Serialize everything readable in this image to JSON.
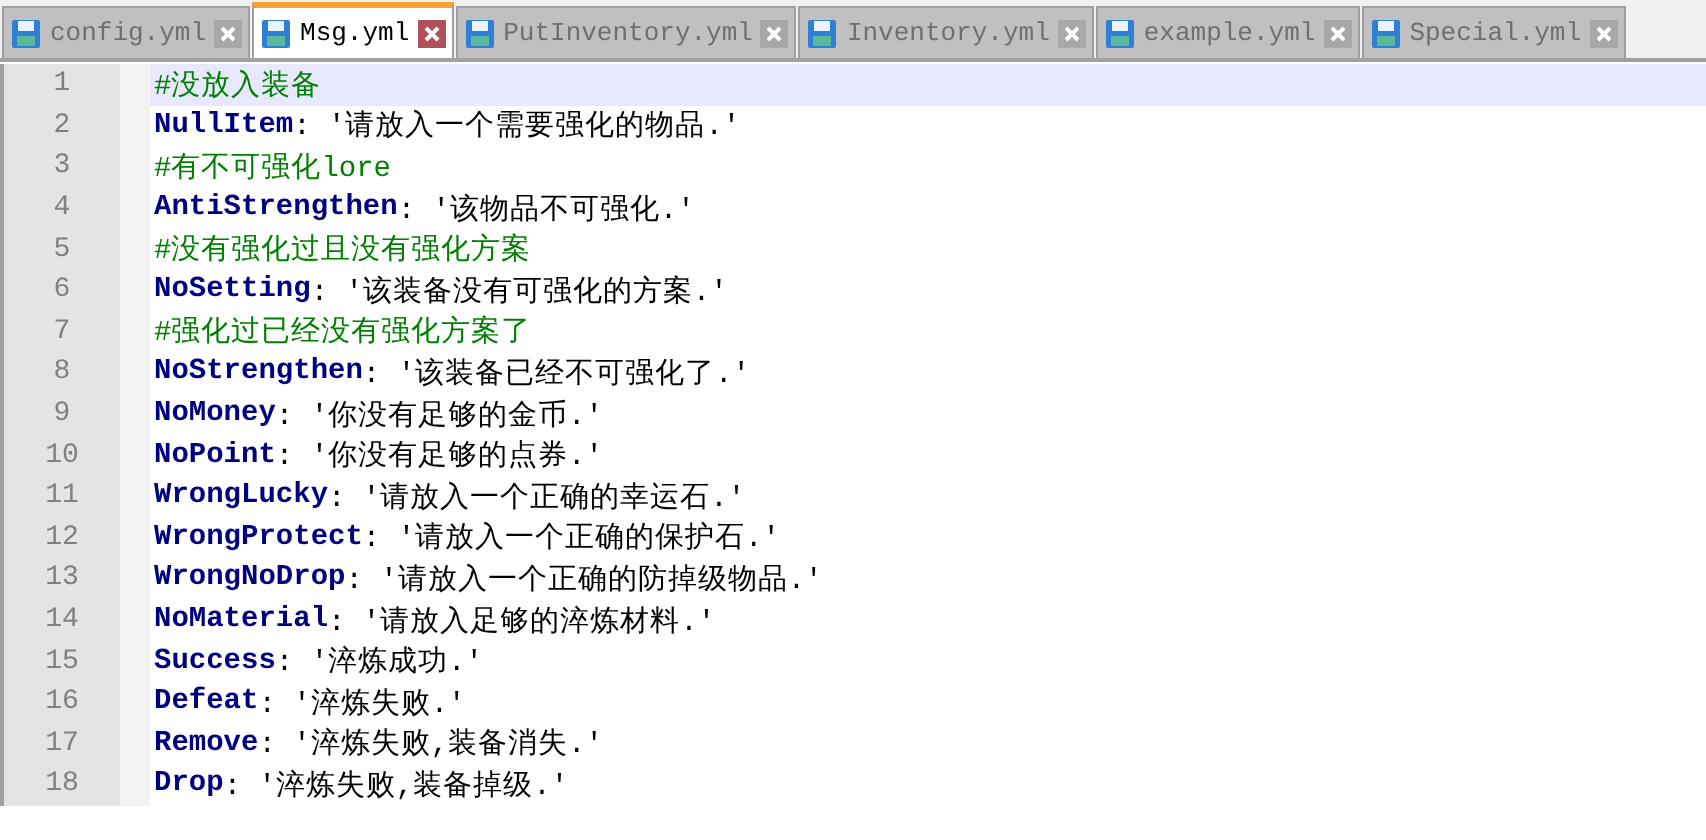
{
  "tabs": [
    {
      "label": "config.yml",
      "selected": false
    },
    {
      "label": "Msg.yml",
      "selected": true
    },
    {
      "label": "PutInventory.yml",
      "selected": false
    },
    {
      "label": "Inventory.yml",
      "selected": false
    },
    {
      "label": "example.yml",
      "selected": false
    },
    {
      "label": "Special.yml",
      "selected": false
    }
  ],
  "lines": [
    {
      "number": "1",
      "kind": "comment",
      "text": "#没放入装备",
      "current": true
    },
    {
      "number": "2",
      "kind": "entry",
      "key": "NullItem",
      "colon": ":",
      "value": "'请放入一个需要强化的物品.'",
      "current": false
    },
    {
      "number": "3",
      "kind": "comment",
      "text": "#有不可强化lore",
      "current": false
    },
    {
      "number": "4",
      "kind": "entry",
      "key": "AntiStrengthen",
      "colon": ":",
      "value": "'该物品不可强化.'",
      "current": false
    },
    {
      "number": "5",
      "kind": "comment",
      "text": "#没有强化过且没有强化方案",
      "current": false
    },
    {
      "number": "6",
      "kind": "entry",
      "key": "NoSetting",
      "colon": ":",
      "value": "'该装备没有可强化的方案.'",
      "current": false
    },
    {
      "number": "7",
      "kind": "comment",
      "text": "#强化过已经没有强化方案了",
      "current": false
    },
    {
      "number": "8",
      "kind": "entry",
      "key": "NoStrengthen",
      "colon": ":",
      "value": "'该装备已经不可强化了.'",
      "current": false
    },
    {
      "number": "9",
      "kind": "entry",
      "key": "NoMoney",
      "colon": ":",
      "value": "'你没有足够的金币.'",
      "current": false
    },
    {
      "number": "10",
      "kind": "entry",
      "key": "NoPoint",
      "colon": ":",
      "value": "'你没有足够的点券.'",
      "current": false
    },
    {
      "number": "11",
      "kind": "entry",
      "key": "WrongLucky",
      "colon": ":",
      "value": "'请放入一个正确的幸运石.'",
      "current": false
    },
    {
      "number": "12",
      "kind": "entry",
      "key": "WrongProtect",
      "colon": ":",
      "value": "'请放入一个正确的保护石.'",
      "current": false
    },
    {
      "number": "13",
      "kind": "entry",
      "key": "WrongNoDrop",
      "colon": ":",
      "value": "'请放入一个正确的防掉级物品.'",
      "current": false
    },
    {
      "number": "14",
      "kind": "entry",
      "key": "NoMaterial",
      "colon": ":",
      "value": "'请放入足够的淬炼材料.'",
      "current": false
    },
    {
      "number": "15",
      "kind": "entry",
      "key": "Success",
      "colon": ":",
      "value": "'淬炼成功.'",
      "current": false
    },
    {
      "number": "16",
      "kind": "entry",
      "key": "Defeat",
      "colon": ":",
      "value": "'淬炼失败.'",
      "current": false
    },
    {
      "number": "17",
      "kind": "entry",
      "key": "Remove",
      "colon": ":",
      "value": "'淬炼失败,装备消失.'",
      "current": false
    },
    {
      "number": "18",
      "kind": "entry",
      "key": "Drop",
      "colon": ":",
      "value": "'淬炼失败,装备掉级.'",
      "current": false
    }
  ]
}
